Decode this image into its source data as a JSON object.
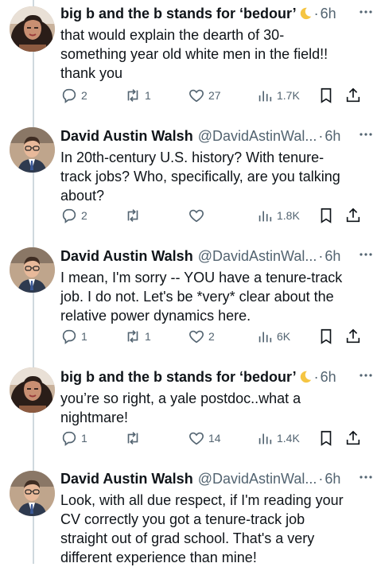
{
  "colors": {
    "text": "#0f1419",
    "secondary": "#536471",
    "thread_line": "#cfd9de"
  },
  "icons": {
    "reply": "reply-icon",
    "retweet": "retweet-icon",
    "like": "heart-icon",
    "views": "views-icon",
    "bookmark": "bookmark-icon",
    "share": "share-icon",
    "more": "more-icon",
    "name_emoji": "crescent-moon-icon"
  },
  "tweets": [
    {
      "name": "big b and the b stands for ‘bedour’",
      "has_emoji": true,
      "handle": "",
      "time": "6h",
      "lines": [
        "that would explain the dearth of  30-",
        "something year old white men in the field!!",
        "thank you"
      ],
      "replies": "2",
      "retweets": "1",
      "likes": "27",
      "views": "1.7K"
    },
    {
      "name": "David Austin Walsh",
      "has_emoji": false,
      "handle": "@DavidAstinWal...",
      "time": "6h",
      "lines": [
        "In 20th-century U.S. history? With tenure-",
        "track jobs? Who, specifically, are you talking",
        "about?"
      ],
      "replies": "2",
      "retweets": "",
      "likes": "",
      "views": "1.8K"
    },
    {
      "name": "David Austin Walsh",
      "has_emoji": false,
      "handle": "@DavidAstinWal...",
      "time": "6h",
      "lines": [
        "I mean, I'm sorry -- YOU have a tenure-track",
        "job. I do not. Let's be *very* clear about the",
        "relative power dynamics here."
      ],
      "replies": "1",
      "retweets": "1",
      "likes": "2",
      "views": "6K"
    },
    {
      "name": "big b and the b stands for ‘bedour’",
      "has_emoji": true,
      "handle": "",
      "time": "6h",
      "lines": [
        "you’re so right, a yale postdoc..what a",
        "nightmare!"
      ],
      "replies": "1",
      "retweets": "",
      "likes": "14",
      "views": "1.4K"
    },
    {
      "name": "David Austin Walsh",
      "has_emoji": false,
      "handle": "@DavidAstinWal...",
      "time": "6h",
      "lines": [
        "Look, with all due respect, if I'm reading your",
        "CV correctly you got a tenure-track job",
        "straight out of grad school. That's a very",
        "different experience than mine!"
      ],
      "replies": "",
      "retweets": "",
      "likes": "",
      "views": ""
    }
  ]
}
